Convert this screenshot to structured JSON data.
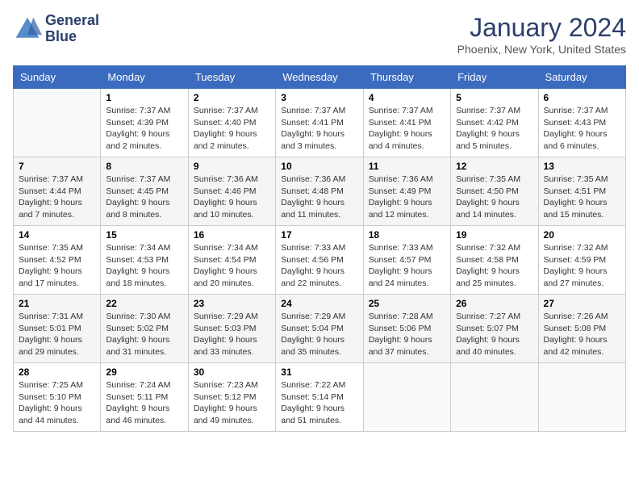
{
  "logo": {
    "line1": "General",
    "line2": "Blue"
  },
  "title": "January 2024",
  "subtitle": "Phoenix, New York, United States",
  "days_header": [
    "Sunday",
    "Monday",
    "Tuesday",
    "Wednesday",
    "Thursday",
    "Friday",
    "Saturday"
  ],
  "weeks": [
    [
      {
        "day": "",
        "info": ""
      },
      {
        "day": "1",
        "info": "Sunrise: 7:37 AM\nSunset: 4:39 PM\nDaylight: 9 hours\nand 2 minutes."
      },
      {
        "day": "2",
        "info": "Sunrise: 7:37 AM\nSunset: 4:40 PM\nDaylight: 9 hours\nand 2 minutes."
      },
      {
        "day": "3",
        "info": "Sunrise: 7:37 AM\nSunset: 4:41 PM\nDaylight: 9 hours\nand 3 minutes."
      },
      {
        "day": "4",
        "info": "Sunrise: 7:37 AM\nSunset: 4:41 PM\nDaylight: 9 hours\nand 4 minutes."
      },
      {
        "day": "5",
        "info": "Sunrise: 7:37 AM\nSunset: 4:42 PM\nDaylight: 9 hours\nand 5 minutes."
      },
      {
        "day": "6",
        "info": "Sunrise: 7:37 AM\nSunset: 4:43 PM\nDaylight: 9 hours\nand 6 minutes."
      }
    ],
    [
      {
        "day": "7",
        "info": "Sunrise: 7:37 AM\nSunset: 4:44 PM\nDaylight: 9 hours\nand 7 minutes."
      },
      {
        "day": "8",
        "info": "Sunrise: 7:37 AM\nSunset: 4:45 PM\nDaylight: 9 hours\nand 8 minutes."
      },
      {
        "day": "9",
        "info": "Sunrise: 7:36 AM\nSunset: 4:46 PM\nDaylight: 9 hours\nand 10 minutes."
      },
      {
        "day": "10",
        "info": "Sunrise: 7:36 AM\nSunset: 4:48 PM\nDaylight: 9 hours\nand 11 minutes."
      },
      {
        "day": "11",
        "info": "Sunrise: 7:36 AM\nSunset: 4:49 PM\nDaylight: 9 hours\nand 12 minutes."
      },
      {
        "day": "12",
        "info": "Sunrise: 7:35 AM\nSunset: 4:50 PM\nDaylight: 9 hours\nand 14 minutes."
      },
      {
        "day": "13",
        "info": "Sunrise: 7:35 AM\nSunset: 4:51 PM\nDaylight: 9 hours\nand 15 minutes."
      }
    ],
    [
      {
        "day": "14",
        "info": "Sunrise: 7:35 AM\nSunset: 4:52 PM\nDaylight: 9 hours\nand 17 minutes."
      },
      {
        "day": "15",
        "info": "Sunrise: 7:34 AM\nSunset: 4:53 PM\nDaylight: 9 hours\nand 18 minutes."
      },
      {
        "day": "16",
        "info": "Sunrise: 7:34 AM\nSunset: 4:54 PM\nDaylight: 9 hours\nand 20 minutes."
      },
      {
        "day": "17",
        "info": "Sunrise: 7:33 AM\nSunset: 4:56 PM\nDaylight: 9 hours\nand 22 minutes."
      },
      {
        "day": "18",
        "info": "Sunrise: 7:33 AM\nSunset: 4:57 PM\nDaylight: 9 hours\nand 24 minutes."
      },
      {
        "day": "19",
        "info": "Sunrise: 7:32 AM\nSunset: 4:58 PM\nDaylight: 9 hours\nand 25 minutes."
      },
      {
        "day": "20",
        "info": "Sunrise: 7:32 AM\nSunset: 4:59 PM\nDaylight: 9 hours\nand 27 minutes."
      }
    ],
    [
      {
        "day": "21",
        "info": "Sunrise: 7:31 AM\nSunset: 5:01 PM\nDaylight: 9 hours\nand 29 minutes."
      },
      {
        "day": "22",
        "info": "Sunrise: 7:30 AM\nSunset: 5:02 PM\nDaylight: 9 hours\nand 31 minutes."
      },
      {
        "day": "23",
        "info": "Sunrise: 7:29 AM\nSunset: 5:03 PM\nDaylight: 9 hours\nand 33 minutes."
      },
      {
        "day": "24",
        "info": "Sunrise: 7:29 AM\nSunset: 5:04 PM\nDaylight: 9 hours\nand 35 minutes."
      },
      {
        "day": "25",
        "info": "Sunrise: 7:28 AM\nSunset: 5:06 PM\nDaylight: 9 hours\nand 37 minutes."
      },
      {
        "day": "26",
        "info": "Sunrise: 7:27 AM\nSunset: 5:07 PM\nDaylight: 9 hours\nand 40 minutes."
      },
      {
        "day": "27",
        "info": "Sunrise: 7:26 AM\nSunset: 5:08 PM\nDaylight: 9 hours\nand 42 minutes."
      }
    ],
    [
      {
        "day": "28",
        "info": "Sunrise: 7:25 AM\nSunset: 5:10 PM\nDaylight: 9 hours\nand 44 minutes."
      },
      {
        "day": "29",
        "info": "Sunrise: 7:24 AM\nSunset: 5:11 PM\nDaylight: 9 hours\nand 46 minutes."
      },
      {
        "day": "30",
        "info": "Sunrise: 7:23 AM\nSunset: 5:12 PM\nDaylight: 9 hours\nand 49 minutes."
      },
      {
        "day": "31",
        "info": "Sunrise: 7:22 AM\nSunset: 5:14 PM\nDaylight: 9 hours\nand 51 minutes."
      },
      {
        "day": "",
        "info": ""
      },
      {
        "day": "",
        "info": ""
      },
      {
        "day": "",
        "info": ""
      }
    ]
  ]
}
